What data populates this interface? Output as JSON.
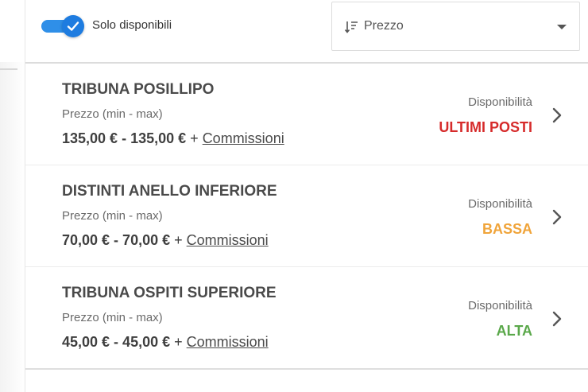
{
  "filters": {
    "only_available_label": "Solo disponibili",
    "only_available_on": true
  },
  "sort": {
    "icon": "sort-icon",
    "selected": "Prezzo"
  },
  "sectors": [
    {
      "name": "TRIBUNA POSILLIPO",
      "price_caption": "Prezzo (min - max)",
      "price_range": "135,00 € - 135,00 €",
      "plus": "+",
      "fees_label": "Commissioni",
      "availability_caption": "Disponibilità",
      "availability_level": "ULTIMI POSTI",
      "availability_color": "#d62b2b"
    },
    {
      "name": "DISTINTI ANELLO INFERIORE",
      "price_caption": "Prezzo (min - max)",
      "price_range": "70,00 € - 70,00 €",
      "plus": "+",
      "fees_label": "Commissioni",
      "availability_caption": "Disponibilità",
      "availability_level": "BASSA",
      "availability_color": "#f0a43a"
    },
    {
      "name": "TRIBUNA OSPITI SUPERIORE",
      "price_caption": "Prezzo (min - max)",
      "price_range": "45,00 € - 45,00 €",
      "plus": "+",
      "fees_label": "Commissioni",
      "availability_caption": "Disponibilità",
      "availability_level": "ALTA",
      "availability_color": "#5aa84a"
    }
  ],
  "colors": {
    "toggle_accent": "#1e7ce0"
  }
}
